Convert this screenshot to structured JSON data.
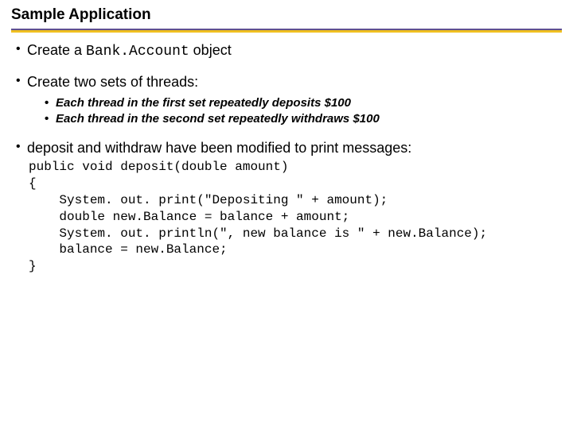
{
  "title": "Sample Application",
  "bullets": {
    "b1_pre": "Create a ",
    "b1_code": "Bank.Account",
    "b1_post": " object",
    "b2": "Create two sets of threads:",
    "b2_sub1": "Each thread in the first set repeatedly deposits $100",
    "b2_sub2": "Each thread in the second set repeatedly withdraws $100",
    "b3": "deposit and withdraw have been modified to print messages:"
  },
  "code": "public void deposit(double amount)\n{\n    System. out. print(\"Depositing \" + amount);\n    double new.Balance = balance + amount;\n    System. out. println(\", new balance is \" + new.Balance);\n    balance = new.Balance;\n}"
}
